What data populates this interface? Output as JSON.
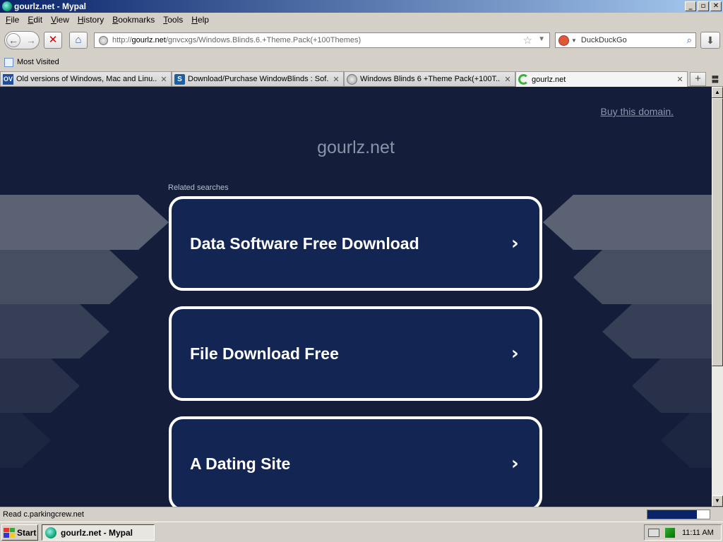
{
  "window": {
    "title": "gourlz.net - Mypal",
    "buttons": [
      "_",
      "▫",
      "✕"
    ]
  },
  "menu": [
    "File",
    "Edit",
    "View",
    "History",
    "Bookmarks",
    "Tools",
    "Help"
  ],
  "menu_access_keys": [
    "F",
    "E",
    "V",
    "H",
    "B",
    "T",
    "H"
  ],
  "nav": {
    "url_prefix": "http://",
    "url_domain": "gourlz.net",
    "url_path": "/gnvcxgs/Windows.Blinds.6.+Theme.Pack(+100Themes)",
    "search_engine": "DuckDuckGo",
    "icons": {
      "back": "back-arrow-icon",
      "forward": "forward-arrow-icon",
      "stop": "stop-icon",
      "home": "home-icon",
      "bookmark": "star-icon",
      "search": "magnifier-icon",
      "downloads": "download-arrow-icon"
    }
  },
  "bookmarks": {
    "most_visited": "Most Visited"
  },
  "tabs": [
    {
      "label": "Old versions of Windows, Mac and Linu...",
      "icon": "ov",
      "active": false
    },
    {
      "label": "Download/Purchase WindowBlinds : Sof...",
      "icon": "wb",
      "active": false
    },
    {
      "label": "Windows Blinds 6 +Theme Pack(+100T...",
      "icon": "globe",
      "active": false
    },
    {
      "label": "gourlz.net",
      "icon": "loading",
      "active": true
    }
  ],
  "tab_icons": {
    "ov": "OV",
    "wb": "S"
  },
  "page": {
    "buy_domain": "Buy this domain.",
    "site_name": "gourlz.net",
    "related_searches": "Related searches",
    "links": [
      "Data Software Free Download",
      "File Download Free",
      "A Dating Site"
    ],
    "background_color": "#141e3a",
    "card_color": "#132552",
    "card_border_color": "#ffffff"
  },
  "status": {
    "text": "Read c.parkingcrew.net",
    "progress": 0.8
  },
  "taskbar": {
    "start": "Start",
    "task": "gourlz.net - Mypal",
    "clock": "11:11 AM"
  }
}
